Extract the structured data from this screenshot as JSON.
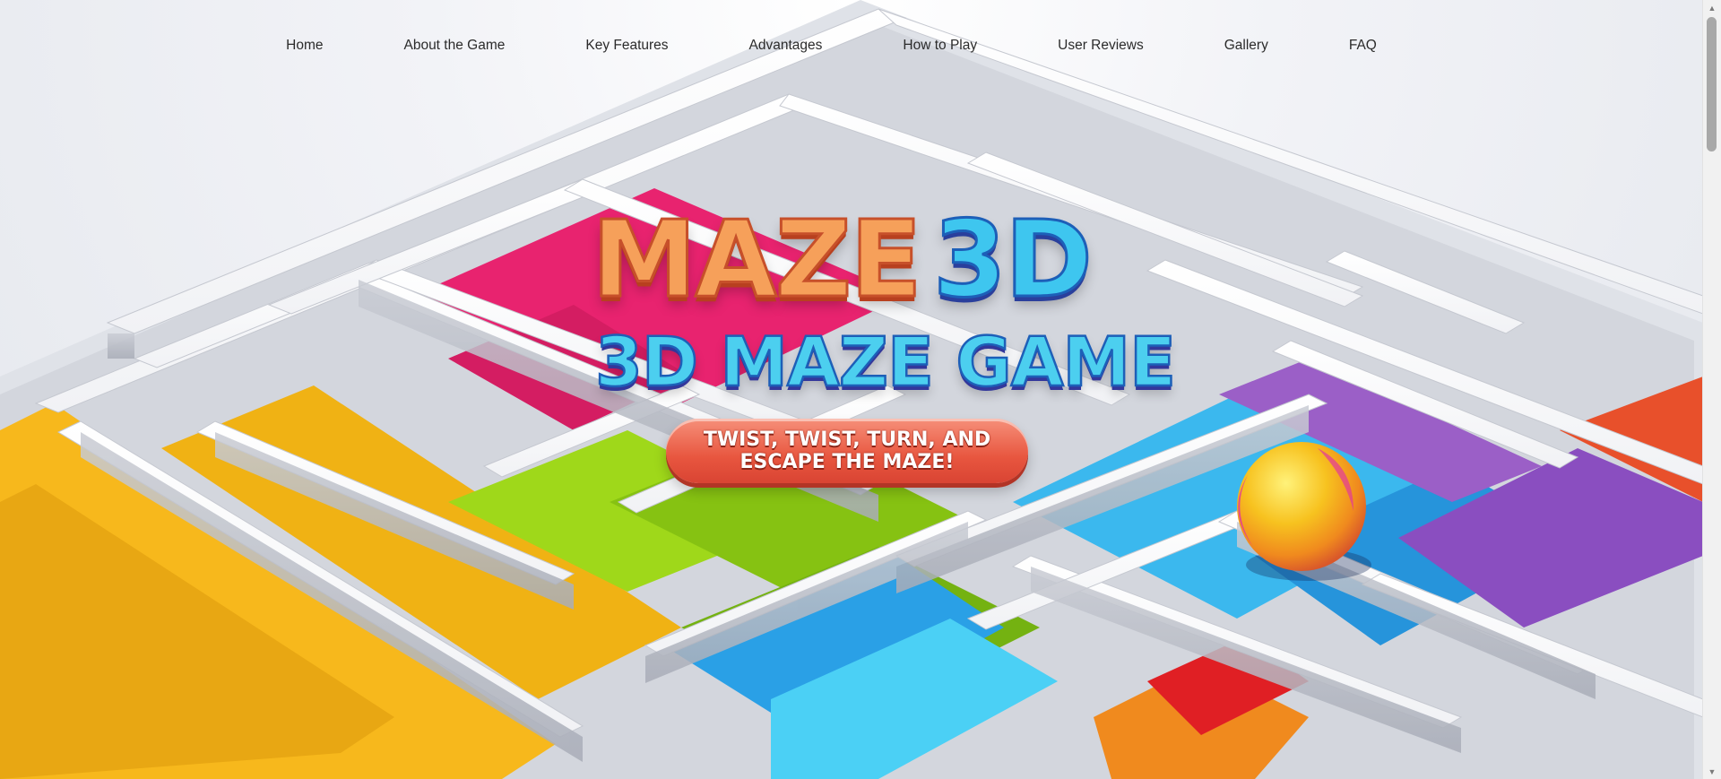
{
  "nav": {
    "items": [
      {
        "label": "Home"
      },
      {
        "label": "About the Game"
      },
      {
        "label": "Key Features"
      },
      {
        "label": "Advantages"
      },
      {
        "label": "How to Play"
      },
      {
        "label": "User Reviews"
      },
      {
        "label": "Gallery"
      },
      {
        "label": "FAQ"
      }
    ]
  },
  "hero": {
    "logo_word1": "MAZE",
    "logo_word2": "3D",
    "logo_subtitle": "3D MAZE GAME",
    "tagline": "TWIST, TWIST, TURN, AND\nESCAPE THE MAZE!",
    "background_image": "colorful-3d-maze-with-ball"
  },
  "colors": {
    "maze_word": "#f6a05a",
    "three_d": "#3ec6ef",
    "badge": "#e8563f",
    "nav_text": "#2b2b2b"
  }
}
